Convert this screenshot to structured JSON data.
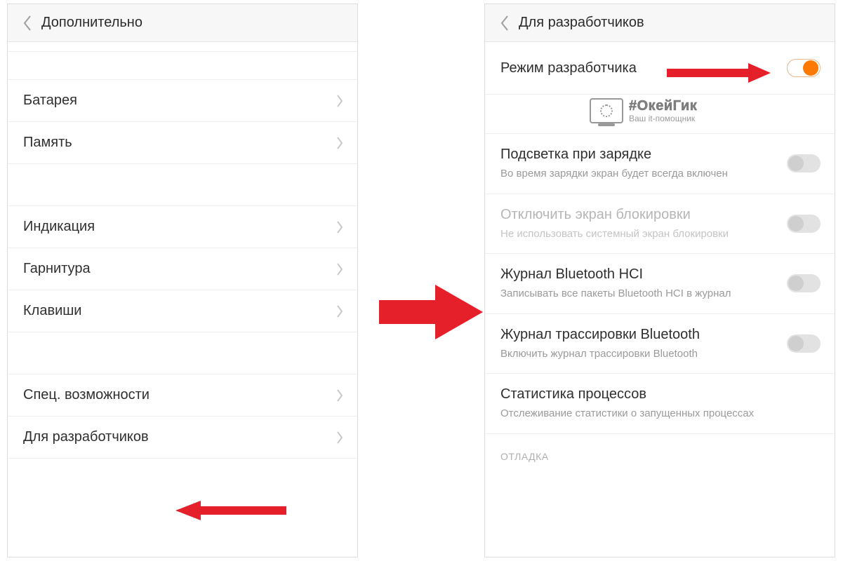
{
  "left": {
    "title": "Дополнительно",
    "items": {
      "battery": "Батарея",
      "memory": "Память",
      "indication": "Индикация",
      "headset": "Гарнитура",
      "keys": "Клавиши",
      "accessibility": "Спец. возможности",
      "developers": "Для разработчиков"
    }
  },
  "right": {
    "title": "Для разработчиков",
    "dev_mode": {
      "label": "Режим разработчика",
      "on": true
    },
    "backlight": {
      "label": "Подсветка при зарядке",
      "sub": "Во время зарядки экран будет всегда включен",
      "on": false
    },
    "lockscreen": {
      "label": "Отключить экран блокировки",
      "sub": "Не использовать системный экран блокировки",
      "on": false,
      "disabled": true
    },
    "bt_hci": {
      "label": "Журнал Bluetooth HCI",
      "sub": "Записывать все пакеты Bluetooth HCI в журнал",
      "on": false
    },
    "bt_trace": {
      "label": "Журнал трассировки Bluetooth",
      "sub": "Включить журнал трассировки Bluetooth",
      "on": false
    },
    "proc_stats": {
      "label": "Статистика процессов",
      "sub": "Отслеживание статистики о запущенных процессах"
    },
    "section_debug": "ОТЛАДКА"
  },
  "watermark": {
    "title": "#ОкейГик",
    "sub": "Ваш it-помощник"
  }
}
